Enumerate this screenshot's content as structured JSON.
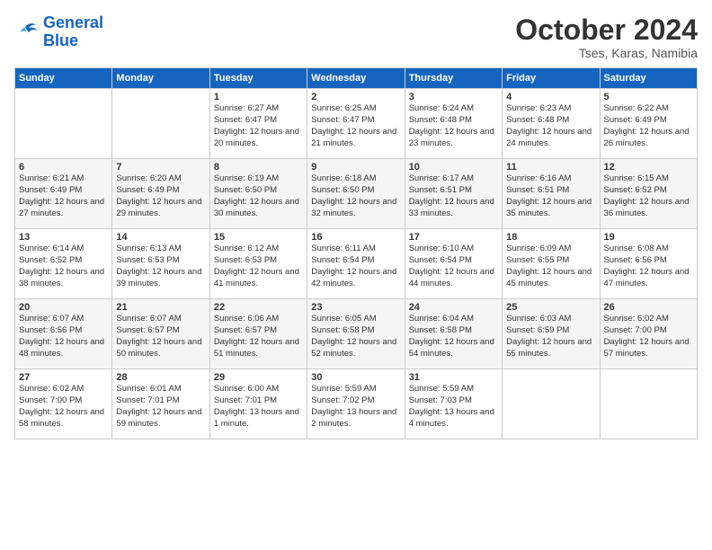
{
  "logo": {
    "line1": "General",
    "line2": "Blue"
  },
  "title": "October 2024",
  "subtitle": "Tses, Karas, Namibia",
  "headers": [
    "Sunday",
    "Monday",
    "Tuesday",
    "Wednesday",
    "Thursday",
    "Friday",
    "Saturday"
  ],
  "weeks": [
    [
      {
        "num": "",
        "info": ""
      },
      {
        "num": "",
        "info": ""
      },
      {
        "num": "1",
        "info": "Sunrise: 6:27 AM\nSunset: 6:47 PM\nDaylight: 12 hours and 20 minutes."
      },
      {
        "num": "2",
        "info": "Sunrise: 6:25 AM\nSunset: 6:47 PM\nDaylight: 12 hours and 21 minutes."
      },
      {
        "num": "3",
        "info": "Sunrise: 6:24 AM\nSunset: 6:48 PM\nDaylight: 12 hours and 23 minutes."
      },
      {
        "num": "4",
        "info": "Sunrise: 6:23 AM\nSunset: 6:48 PM\nDaylight: 12 hours and 24 minutes."
      },
      {
        "num": "5",
        "info": "Sunrise: 6:22 AM\nSunset: 6:49 PM\nDaylight: 12 hours and 26 minutes."
      }
    ],
    [
      {
        "num": "6",
        "info": "Sunrise: 6:21 AM\nSunset: 6:49 PM\nDaylight: 12 hours and 27 minutes."
      },
      {
        "num": "7",
        "info": "Sunrise: 6:20 AM\nSunset: 6:49 PM\nDaylight: 12 hours and 29 minutes."
      },
      {
        "num": "8",
        "info": "Sunrise: 6:19 AM\nSunset: 6:50 PM\nDaylight: 12 hours and 30 minutes."
      },
      {
        "num": "9",
        "info": "Sunrise: 6:18 AM\nSunset: 6:50 PM\nDaylight: 12 hours and 32 minutes."
      },
      {
        "num": "10",
        "info": "Sunrise: 6:17 AM\nSunset: 6:51 PM\nDaylight: 12 hours and 33 minutes."
      },
      {
        "num": "11",
        "info": "Sunrise: 6:16 AM\nSunset: 6:51 PM\nDaylight: 12 hours and 35 minutes."
      },
      {
        "num": "12",
        "info": "Sunrise: 6:15 AM\nSunset: 6:52 PM\nDaylight: 12 hours and 36 minutes."
      }
    ],
    [
      {
        "num": "13",
        "info": "Sunrise: 6:14 AM\nSunset: 6:52 PM\nDaylight: 12 hours and 38 minutes."
      },
      {
        "num": "14",
        "info": "Sunrise: 6:13 AM\nSunset: 6:53 PM\nDaylight: 12 hours and 39 minutes."
      },
      {
        "num": "15",
        "info": "Sunrise: 6:12 AM\nSunset: 6:53 PM\nDaylight: 12 hours and 41 minutes."
      },
      {
        "num": "16",
        "info": "Sunrise: 6:11 AM\nSunset: 6:54 PM\nDaylight: 12 hours and 42 minutes."
      },
      {
        "num": "17",
        "info": "Sunrise: 6:10 AM\nSunset: 6:54 PM\nDaylight: 12 hours and 44 minutes."
      },
      {
        "num": "18",
        "info": "Sunrise: 6:09 AM\nSunset: 6:55 PM\nDaylight: 12 hours and 45 minutes."
      },
      {
        "num": "19",
        "info": "Sunrise: 6:08 AM\nSunset: 6:56 PM\nDaylight: 12 hours and 47 minutes."
      }
    ],
    [
      {
        "num": "20",
        "info": "Sunrise: 6:07 AM\nSunset: 6:56 PM\nDaylight: 12 hours and 48 minutes."
      },
      {
        "num": "21",
        "info": "Sunrise: 6:07 AM\nSunset: 6:57 PM\nDaylight: 12 hours and 50 minutes."
      },
      {
        "num": "22",
        "info": "Sunrise: 6:06 AM\nSunset: 6:57 PM\nDaylight: 12 hours and 51 minutes."
      },
      {
        "num": "23",
        "info": "Sunrise: 6:05 AM\nSunset: 6:58 PM\nDaylight: 12 hours and 52 minutes."
      },
      {
        "num": "24",
        "info": "Sunrise: 6:04 AM\nSunset: 6:58 PM\nDaylight: 12 hours and 54 minutes."
      },
      {
        "num": "25",
        "info": "Sunrise: 6:03 AM\nSunset: 6:59 PM\nDaylight: 12 hours and 55 minutes."
      },
      {
        "num": "26",
        "info": "Sunrise: 6:02 AM\nSunset: 7:00 PM\nDaylight: 12 hours and 57 minutes."
      }
    ],
    [
      {
        "num": "27",
        "info": "Sunrise: 6:02 AM\nSunset: 7:00 PM\nDaylight: 12 hours and 58 minutes."
      },
      {
        "num": "28",
        "info": "Sunrise: 6:01 AM\nSunset: 7:01 PM\nDaylight: 12 hours and 59 minutes."
      },
      {
        "num": "29",
        "info": "Sunrise: 6:00 AM\nSunset: 7:01 PM\nDaylight: 13 hours and 1 minute."
      },
      {
        "num": "30",
        "info": "Sunrise: 5:59 AM\nSunset: 7:02 PM\nDaylight: 13 hours and 2 minutes."
      },
      {
        "num": "31",
        "info": "Sunrise: 5:59 AM\nSunset: 7:03 PM\nDaylight: 13 hours and 4 minutes."
      },
      {
        "num": "",
        "info": ""
      },
      {
        "num": "",
        "info": ""
      }
    ]
  ]
}
